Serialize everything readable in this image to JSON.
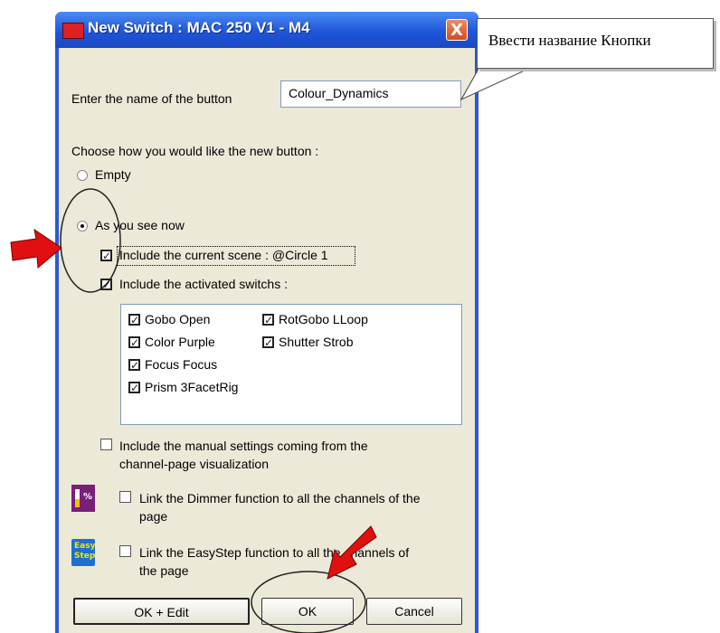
{
  "window": {
    "title": "New Switch : MAC 250 V1 - M4",
    "close_label": "X"
  },
  "callout": {
    "text": "Ввести название Кнопки"
  },
  "name_row": {
    "label": "Enter the name of the button",
    "value": "Colour_Dynamics"
  },
  "choose": {
    "label": "Choose how you would like the new button :",
    "options": [
      {
        "label": "Empty",
        "selected": false
      },
      {
        "label": "As you see now",
        "selected": true
      }
    ]
  },
  "include_scene": {
    "label": "Include the current scene : @Circle 1",
    "checked": true
  },
  "include_switchs": {
    "label": "Include the activated switchs :",
    "checked": true
  },
  "switch_list": {
    "col1": [
      "Gobo Open",
      "Color Purple",
      "Focus Focus",
      "Prism 3FacetRig"
    ],
    "col2": [
      "RotGobo LLoop",
      "Shutter Strob"
    ]
  },
  "manual": {
    "line1": "Include the manual settings coming from the",
    "line2": "channel-page visualization",
    "checked": false
  },
  "dimmer": {
    "icon_text": "%",
    "line1": "Link the Dimmer function to all the channels of the",
    "line2": "page",
    "checked": false
  },
  "easystep": {
    "icon_line1": "Easy",
    "icon_line2": "Step",
    "line1": "Link the EasyStep function to all the channels of",
    "line2": "the page",
    "checked": false
  },
  "buttons": {
    "ok_edit": "OK + Edit",
    "ok": "OK",
    "cancel": "Cancel"
  },
  "colors": {
    "titlebar": "#1f56d8",
    "client_bg": "#ece9d8",
    "arrow": "#e01010",
    "dimmer_icon": "#7a1f7a",
    "easystep_icon": "#1e6fd0"
  }
}
